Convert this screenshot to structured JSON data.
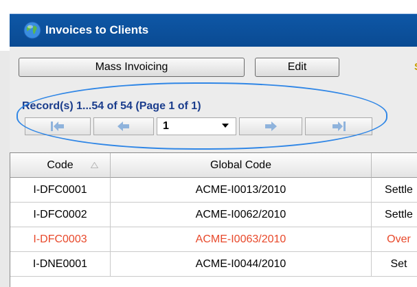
{
  "window": {
    "title": "Invoices to Clients"
  },
  "toolbar": {
    "mass_invoicing": "Mass Invoicing",
    "edit": "Edit",
    "stray_char": "S"
  },
  "pager": {
    "record_text": "Record(s) 1...54 of 54 (Page 1 of 1)",
    "page_select_value": "1"
  },
  "grid": {
    "headers": [
      "Code",
      "Global Code",
      ""
    ],
    "rows": [
      {
        "code": "I-DFC0001",
        "global_code": "ACME-I0013/2010",
        "status": "Settle",
        "highlight": false
      },
      {
        "code": "I-DFC0002",
        "global_code": "ACME-I0062/2010",
        "status": "Settle",
        "highlight": false
      },
      {
        "code": "I-DFC0003",
        "global_code": "ACME-I0063/2010",
        "status": "Over",
        "highlight": true
      },
      {
        "code": "I-DNE0001",
        "global_code": "ACME-I0044/2010",
        "status": "Set",
        "highlight": false
      }
    ]
  },
  "colors": {
    "title_bar": "#0e57a6",
    "record_text": "#1a3c8c",
    "overdue_row": "#e8482a",
    "highlight_ring": "#2f86e6"
  }
}
